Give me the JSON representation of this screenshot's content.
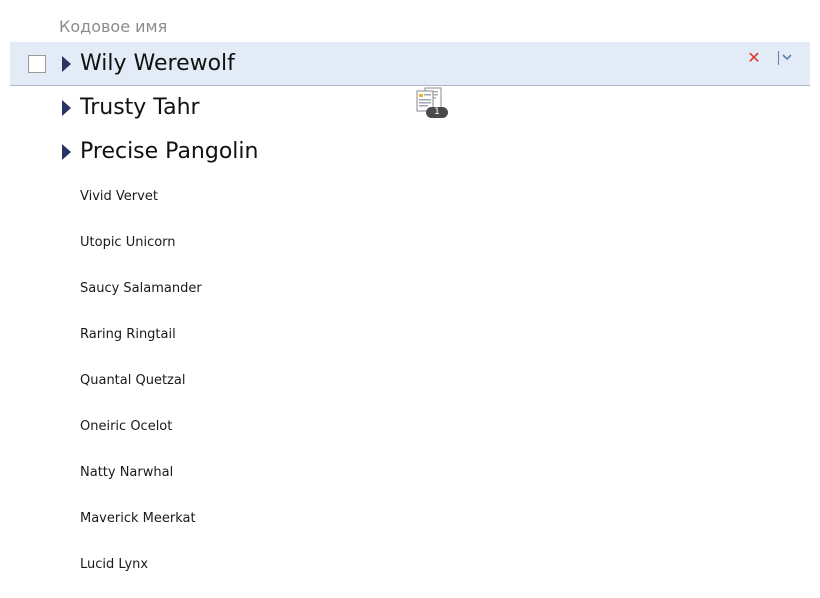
{
  "column_header": "Кодовое имя",
  "groups": [
    {
      "label": "Wily Werewolf",
      "selected": true
    },
    {
      "label": "Trusty Tahr",
      "selected": false
    },
    {
      "label": "Precise Pangolin",
      "selected": false
    }
  ],
  "row_actions": {
    "remove_icon": "close-x-icon",
    "menu_icon": "chevron-down-menu-icon",
    "remove_color": "#e03131",
    "menu_color": "#5a7fb0"
  },
  "drag_indicator": {
    "icon": "documents-copy-icon",
    "count": "1"
  },
  "leaves": [
    "Vivid Vervet",
    "Utopic Unicorn",
    "Saucy Salamander",
    "Raring Ringtail",
    "Quantal Quetzal",
    "Oneiric Ocelot",
    "Natty Narwhal",
    "Maverick Meerkat",
    "Lucid Lynx"
  ],
  "colors": {
    "selected_row_bg": "#e3ecf6",
    "expand_arrow": "#2a3566",
    "header_text": "#8c8c8c"
  }
}
